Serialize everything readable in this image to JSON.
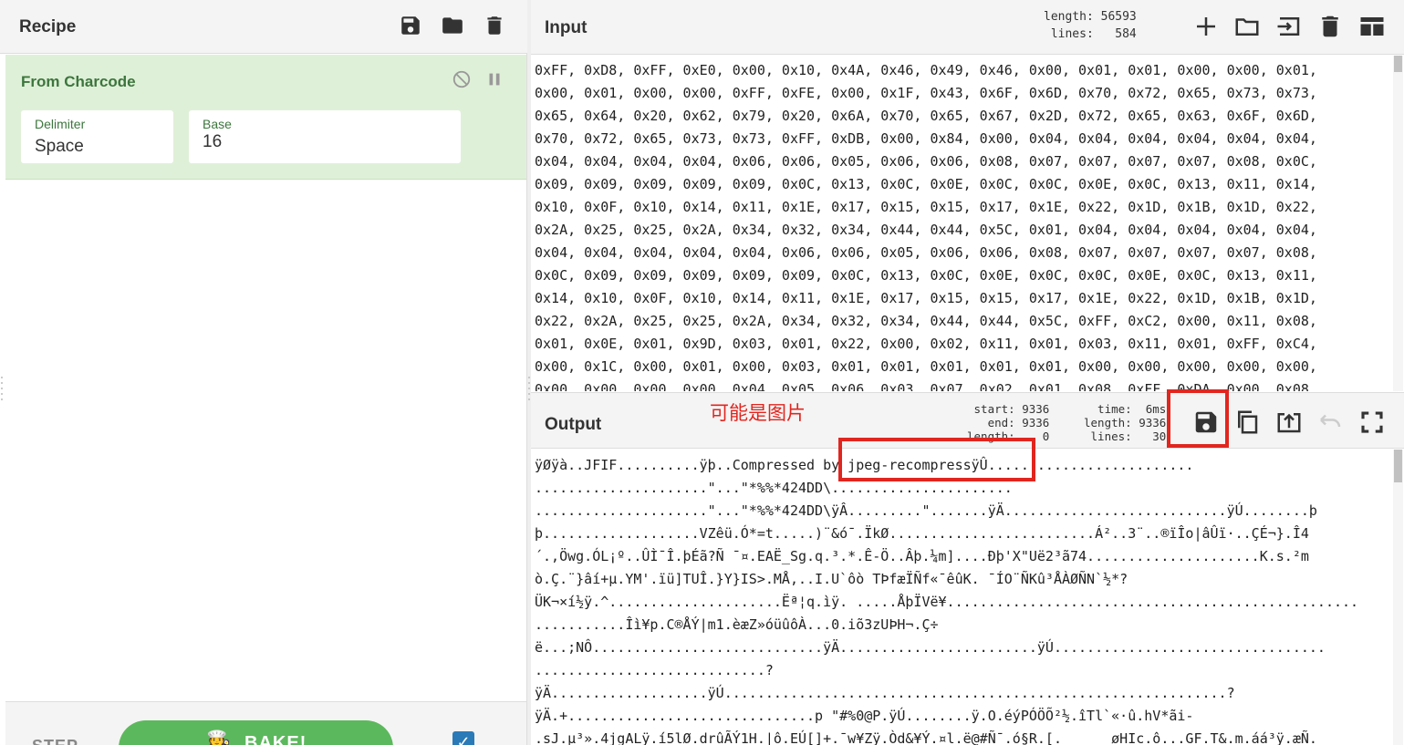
{
  "recipe": {
    "title": "Recipe",
    "icons": [
      "save-icon",
      "folder-icon",
      "trash-icon"
    ],
    "operation": {
      "name": "From Charcode",
      "args": [
        {
          "label": "Delimiter",
          "value": "Space"
        },
        {
          "label": "Base",
          "value": "16"
        }
      ]
    },
    "footer": {
      "step_label": "STEP",
      "bake_label": "BAKE!",
      "bake_icon": "🧑‍🍳",
      "auto_bake_checked": true
    }
  },
  "input": {
    "title": "Input",
    "stats_text": "length: 56593\n lines:   584",
    "text": "0xFF, 0xD8, 0xFF, 0xE0, 0x00, 0x10, 0x4A, 0x46, 0x49, 0x46, 0x00, 0x01, 0x01, 0x00, 0x00, 0x01,\n0x00, 0x01, 0x00, 0x00, 0xFF, 0xFE, 0x00, 0x1F, 0x43, 0x6F, 0x6D, 0x70, 0x72, 0x65, 0x73, 0x73,\n0x65, 0x64, 0x20, 0x62, 0x79, 0x20, 0x6A, 0x70, 0x65, 0x67, 0x2D, 0x72, 0x65, 0x63, 0x6F, 0x6D,\n0x70, 0x72, 0x65, 0x73, 0x73, 0xFF, 0xDB, 0x00, 0x84, 0x00, 0x04, 0x04, 0x04, 0x04, 0x04, 0x04,\n0x04, 0x04, 0x04, 0x04, 0x06, 0x06, 0x05, 0x06, 0x06, 0x08, 0x07, 0x07, 0x07, 0x07, 0x08, 0x0C,\n0x09, 0x09, 0x09, 0x09, 0x09, 0x0C, 0x13, 0x0C, 0x0E, 0x0C, 0x0C, 0x0E, 0x0C, 0x13, 0x11, 0x14,\n0x10, 0x0F, 0x10, 0x14, 0x11, 0x1E, 0x17, 0x15, 0x15, 0x17, 0x1E, 0x22, 0x1D, 0x1B, 0x1D, 0x22,\n0x2A, 0x25, 0x25, 0x2A, 0x34, 0x32, 0x34, 0x44, 0x44, 0x5C, 0x01, 0x04, 0x04, 0x04, 0x04, 0x04,\n0x04, 0x04, 0x04, 0x04, 0x04, 0x06, 0x06, 0x05, 0x06, 0x06, 0x08, 0x07, 0x07, 0x07, 0x07, 0x08,\n0x0C, 0x09, 0x09, 0x09, 0x09, 0x09, 0x0C, 0x13, 0x0C, 0x0E, 0x0C, 0x0C, 0x0E, 0x0C, 0x13, 0x11,\n0x14, 0x10, 0x0F, 0x10, 0x14, 0x11, 0x1E, 0x17, 0x15, 0x15, 0x17, 0x1E, 0x22, 0x1D, 0x1B, 0x1D,\n0x22, 0x2A, 0x25, 0x25, 0x2A, 0x34, 0x32, 0x34, 0x44, 0x44, 0x5C, 0xFF, 0xC2, 0x00, 0x11, 0x08,\n0x01, 0x0E, 0x01, 0x9D, 0x03, 0x01, 0x22, 0x00, 0x02, 0x11, 0x01, 0x03, 0x11, 0x01, 0xFF, 0xC4,\n0x00, 0x1C, 0x00, 0x01, 0x00, 0x03, 0x01, 0x01, 0x01, 0x01, 0x01, 0x00, 0x00, 0x00, 0x00, 0x00,\n0x00, 0x00, 0x00, 0x00, 0x04, 0x05, 0x06, 0x03, 0x07, 0x02, 0x01, 0x08, 0xFF, 0xDA, 0x00, 0x08,",
    "tools": [
      "add-icon",
      "open-folder-icon",
      "load-file-icon",
      "clear-icon",
      "layout-icon"
    ]
  },
  "output": {
    "title": "Output",
    "annotation": "可能是图片",
    "stats_left": "start: 9336\n  end: 9336\nlength:    0",
    "stats_right": "  time:  6ms\nlength: 9336\n lines:   30",
    "tools": [
      "save-output-icon",
      "copy-icon",
      "replace-input-icon",
      "undo-icon",
      "fullscreen-icon"
    ],
    "text": "ÿØÿà..JFIF..........ÿþ..Compressed by jpeg-recompressÿÛ.........................\n.....................\"...\"*%%*424DD\\......................\n.....................\"...\"*%%*424DD\\ÿÂ.........\".......ÿÄ...........................ÿÚ........þ\nþ...................VZêü.Ó*=t.....)¨&ó¯.ÏkØ.........................Á²..3¨..®ïÎo|âÛï·..ÇÉ¬}.Î4\n´.,Öwg.ÓL¡º..ÛÌ¯Î.þÉã?Ñ ¯¤.EAË_Sg.q.³.*.Ê-Ö..Âþ.¼m]....Ðþ'X\"Uë2³ã74.....................K.s.²m\nò.Ç.¨}âí+µ.YM'.ïü]TUÎ.}Y}IS>.MÅ,..I.U`ôò TÞfæÏÑf«¯êûK. ¯ÍO¨ÑKû³ÅÀØÑN`½*?\nÜK¬×í½ÿ.^.....................Ëª¦q.ìÿ. .....ÅþÏVë¥..................................................\n...........Îì¥p.C®ÅÝ|m1.èæZ»óüûôÀ...0.iõ3zUÞH¬.Ç÷\në...;NÔ............................ÿÄ........................ÿÚ.................................\n............................?\nÿÄ...................ÿÚ.............................................................?\nÿÄ.+..............................p \"#%0@P.ÿÚ........ÿ.O.éýPÓÖÕ²½.îTl`«·û.hV*ãi-\n.sJ.µ³».4jgALÿ.í5lØ.drûÃÝ1H.|ô.EÚ[]+.¯w¥Zÿ.Òd&¥Ý.¤l.ë@#Ñ¯.ó§R.[.      øHIc.ô...GF.T&.m.áá³ÿ.æÑ."
  }
}
